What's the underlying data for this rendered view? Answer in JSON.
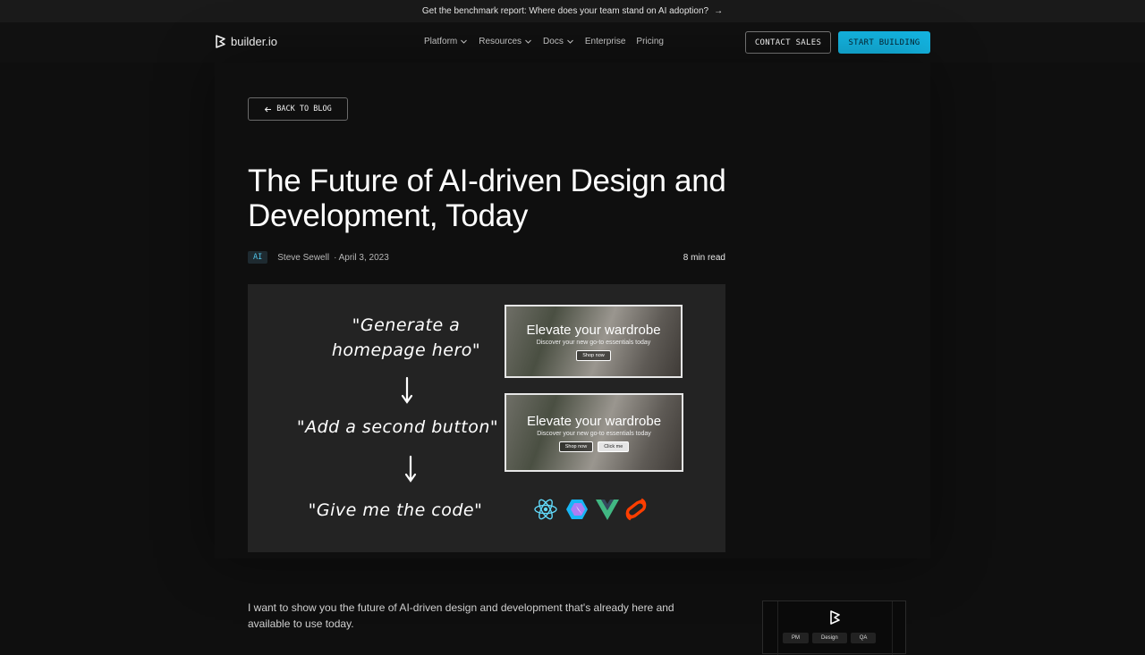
{
  "announcement": {
    "text": "Get the benchmark report: Where does your team stand on AI adoption?",
    "arrow": "→"
  },
  "nav": {
    "brand": "builder.io",
    "items": [
      {
        "label": "Platform",
        "dropdown": true
      },
      {
        "label": "Resources",
        "dropdown": true
      },
      {
        "label": "Docs",
        "dropdown": true
      },
      {
        "label": "Enterprise",
        "dropdown": false
      },
      {
        "label": "Pricing",
        "dropdown": false
      }
    ],
    "contact_label": "CONTACT SALES",
    "start_label": "START BUILDING"
  },
  "article": {
    "back_label": "BACK TO BLOG",
    "title_line1": "The Future of AI-driven Design and",
    "title_line2": "Development, Today",
    "tag": "AI",
    "author": "Steve Sewell",
    "date": "· April 3, 2023",
    "read_time": "8 min read",
    "hero": {
      "step1_line1": "\"Generate a",
      "step1_line2": "homepage hero\"",
      "step2": "\"Add a second button\"",
      "step3": "\"Give me the code\"",
      "card1": {
        "heading": "Elevate your wardrobe",
        "sub": "Discover your new go-to essentials today",
        "button": "Shop now"
      },
      "card2": {
        "heading": "Elevate your wardrobe",
        "sub": "Discover your new go-to essentials today",
        "button1": "Shop now",
        "button2": "Click me"
      }
    },
    "intro_line1": "I want to show you the future of AI-driven design and development that's already here and",
    "intro_line2": "available to use today."
  },
  "side_panel": {
    "chips": [
      "PM",
      "Design",
      "QA"
    ]
  },
  "colors": {
    "accent": "#14b8e6",
    "background": "#0f0f0f",
    "tag_text": "#4fc3e8"
  }
}
